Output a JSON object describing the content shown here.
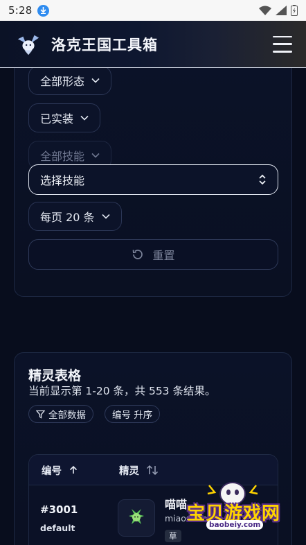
{
  "status_bar": {
    "time": "5:28"
  },
  "app": {
    "title": "洛克王国工具箱"
  },
  "filters": {
    "form": "全部形态",
    "implemented": "已实装",
    "skill_scope": "全部技能",
    "skill_select": "选择技能",
    "page_size": "每页 20 条",
    "reset_label": "重置"
  },
  "table_card": {
    "title": "精灵表格",
    "subtitle": "当前显示第 1-20 条，共 553 条结果。",
    "tag_all": "全部数据",
    "tag_sort": "编号 升序",
    "columns": {
      "id": "编号",
      "sprite": "精灵"
    },
    "rows": [
      {
        "id": "#3001",
        "form": "default",
        "name": "喵喵",
        "pinyin": "miaomiao",
        "type": "草"
      }
    ]
  },
  "watermark": {
    "brand": "宝贝游戏网",
    "url": "baobeiy.com"
  },
  "colors": {
    "background": "#080d1d",
    "card": "#0b1228",
    "accent_border": "#dfe4ee",
    "watermark_yellow": "#ffd400"
  }
}
